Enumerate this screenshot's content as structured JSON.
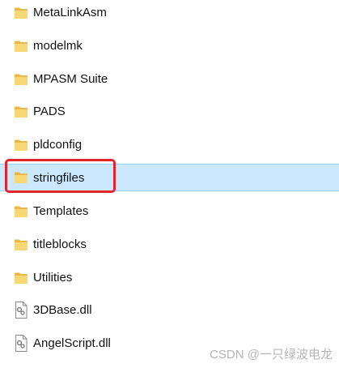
{
  "items": [
    {
      "name": "MetaLinkAsm",
      "type": "folder",
      "icon": "folder-icon"
    },
    {
      "name": "modelmk",
      "type": "folder",
      "icon": "folder-icon"
    },
    {
      "name": "MPASM Suite",
      "type": "folder",
      "icon": "folder-icon"
    },
    {
      "name": "PADS",
      "type": "folder",
      "icon": "folder-icon"
    },
    {
      "name": "pldconfig",
      "type": "folder",
      "icon": "folder-icon"
    },
    {
      "name": "stringfiles",
      "type": "folder",
      "icon": "folder-icon",
      "selected": true,
      "highlighted": true
    },
    {
      "name": "Templates",
      "type": "folder",
      "icon": "folder-icon"
    },
    {
      "name": "titleblocks",
      "type": "folder",
      "icon": "folder-icon"
    },
    {
      "name": "Utilities",
      "type": "folder",
      "icon": "folder-icon"
    },
    {
      "name": "3DBase.dll",
      "type": "dll",
      "icon": "dll-file-icon"
    },
    {
      "name": "AngelScript.dll",
      "type": "dll",
      "icon": "dll-file-icon"
    }
  ],
  "watermark": "CSDN @一只绿波电龙",
  "colors": {
    "selection_background": "#cce8ff",
    "selection_border": "#99d1ff",
    "highlight_box": "#e0262c",
    "folder": "#f8d775"
  }
}
